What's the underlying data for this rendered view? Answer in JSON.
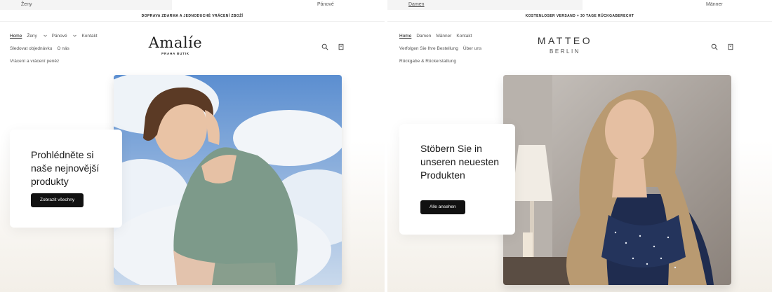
{
  "left_store": {
    "gender_tabs": [
      "Ženy",
      "Pánové"
    ],
    "announcement": "DOPRAVA ZDARMA A JEDNODUCHÉ VRÁCENÍ ZBOŽÍ",
    "nav": [
      "Home",
      "Ženy",
      "Pánové",
      "Kontakt",
      "Sledovat objednávku",
      "O nás",
      "Vrácení a vrácení peněz"
    ],
    "logo_name": "Amalíe",
    "logo_sub": "PRAHA BUTIK",
    "hero_title": "Prohlédněte si naše nejnovější produkty",
    "hero_button": "Zobrazit všechny"
  },
  "right_store": {
    "gender_tabs": [
      "Damen",
      "Männer"
    ],
    "announcement": "KOSTENLOSER VERSAND + 30 TAGE RÜCKGABERECHT",
    "nav": [
      "Home",
      "Damen",
      "Männer",
      "Kontakt",
      "Verfolgen Sie Ihre Bestellung",
      "Über uns",
      "Rückgabe & Rückerstattung"
    ],
    "logo_name": "MATTEO",
    "logo_sub": "BERLIN",
    "hero_title": "Stöbern Sie in unseren neuesten Produkten",
    "hero_button": "Alle ansehen"
  },
  "icons": [
    "search-icon",
    "cart-icon",
    "chevron-down-icon"
  ],
  "colors": {
    "button": "#111111",
    "background_fade": "#f3efe8"
  }
}
